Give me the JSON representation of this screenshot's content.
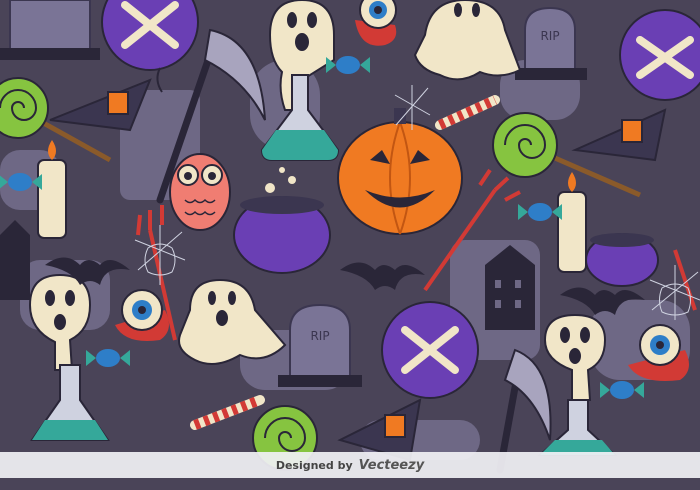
{
  "pattern": {
    "background_color": "#4a4458",
    "shadow_color": "#6e6885",
    "motifs": [
      "tombstone-rip",
      "ghost",
      "pumpkin",
      "cauldron",
      "owl",
      "eyeball",
      "candle",
      "lollipop",
      "candy",
      "witch-hat",
      "scythe",
      "pitchfork",
      "crossbones-balloon",
      "potion-flask",
      "bat",
      "spider-web",
      "haunted-house"
    ]
  },
  "tombstones": {
    "label": "RIP"
  },
  "credit": {
    "prefix": "Designed by",
    "brand": "Vecteezy"
  },
  "colors": {
    "pumpkin": "#f07a22",
    "ghost": "#f1e6c8",
    "purple": "#6a3fb4",
    "lollipop_green": "#86c440",
    "potion_teal": "#35a89a",
    "red": "#d23a35",
    "eyeball_blue": "#2e7ec8",
    "owl": "#f07d72"
  }
}
